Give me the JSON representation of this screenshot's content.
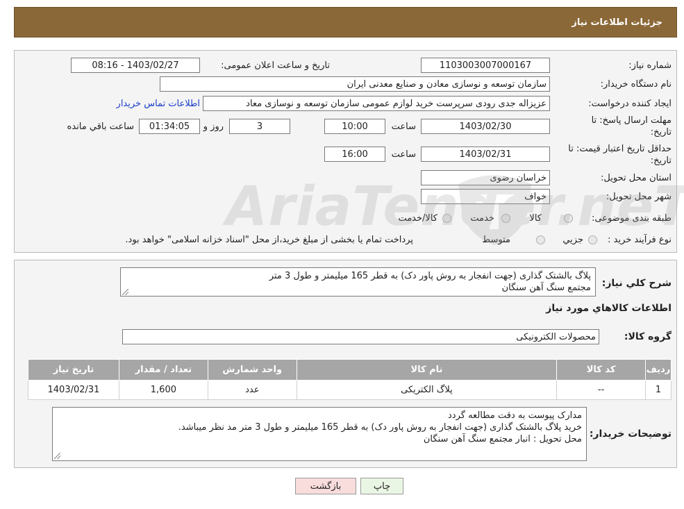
{
  "header": {
    "title": "جزئیات اطلاعات نیاز"
  },
  "form": {
    "need_number_label": "شماره نیاز:",
    "need_number": "1103003007000167",
    "announce_label": "تاریخ و ساعت اعلان عمومی:",
    "announce_value": "1403/02/27 - 08:16",
    "buyer_org_label": "نام دستگاه خریدار:",
    "buyer_org": "سازمان توسعه و نوسازی معادن و صنایع معدنی ایران",
    "requester_label": "ایجاد کننده درخواست:",
    "requester": "عزیزاله جدی رودی سرپرست خرید لوازم عمومی  سازمان توسعه و نوسازی معاد",
    "contact_link": "اطلاعات تماس خریدار",
    "deadline_label_1": "مهلت ارسال پاسخ: تا",
    "deadline_label_2": "تاریخ:",
    "deadline_date": "1403/02/30",
    "time_label": "ساعت",
    "deadline_time": "10:00",
    "days_value": "3",
    "days_label": "روز و",
    "remaining_time": "01:34:05",
    "remaining_label": "ساعت باقي مانده",
    "validity_label_1": "حداقل تاریخ اعتبار قیمت: تا",
    "validity_label_2": "تاریخ:",
    "validity_date": "1403/02/31",
    "validity_time": "16:00",
    "province_label": "استان محل تحویل:",
    "province": "خراسان رضوی",
    "city_label": "شهر محل تحویل:",
    "city": "خواف",
    "category_label": "طبقه بندی موضوعی:",
    "category_options": [
      "کالا",
      "خدمت",
      "کالا/خدمت"
    ],
    "process_label": "نوع فرآیند خرید :",
    "process_options": [
      "جزیي",
      "متوسط"
    ],
    "process_note": "پرداخت تمام یا بخشی از مبلغ خرید،از محل \"اسناد خزانه اسلامی\" خواهد بود."
  },
  "description": {
    "label": "شرح کلي نياز:",
    "text": "پلاگ بالشتک گذاری (جهت انفجار به روش پاور دک) به قطر 165 میلیمتر و طول 3 متر\nمجتمع سنگ آهن سنگان"
  },
  "goods": {
    "section_title": "اطلاعات کالاهاي مورد نياز",
    "group_label": "گروه کالا:",
    "group_value": "محصولات الکترونیکی",
    "columns": [
      "رديف",
      "کد کالا",
      "نام کالا",
      "واحد شمارش",
      "تعداد / مقدار",
      "تاريخ نياز"
    ],
    "rows": [
      [
        "1",
        "--",
        "پلاگ الکتریکی",
        "عدد",
        "1,600",
        "1403/02/31"
      ]
    ]
  },
  "buyer_notes": {
    "label": "توضیحات خریدار:",
    "text": "مدارک پیوست به دقت مطالعه گردد\nخرید  پلاگ بالشتک گذاری (جهت انفجار به روش پاور دک) به قطر 165 میلیمتر و طول 3 متر مد نظر میباشد.\nمحل تحویل : انبار مجتمع سنگ آهن سنگان"
  },
  "buttons": {
    "print": "چاپ",
    "back": "بازگشت"
  },
  "watermark": {
    "text": "AriaTender.neT"
  },
  "colors": {
    "header": "#8b6838",
    "link": "#1a3fc9",
    "back_button": "#f9dcdc",
    "print_button": "#eaf6e4"
  }
}
